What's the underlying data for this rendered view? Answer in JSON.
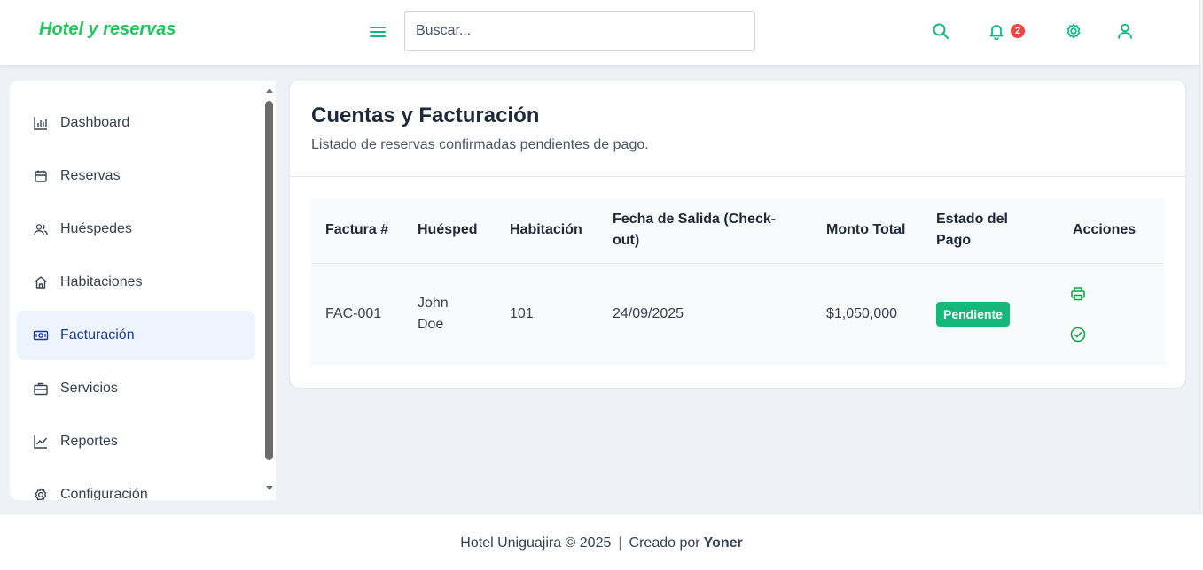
{
  "app": {
    "brand": "Hotel y reservas",
    "accent_color": "#22c55e"
  },
  "header": {
    "search_placeholder": "Buscar...",
    "notification_count": "2",
    "icons": [
      "menu-icon",
      "search-icon",
      "bell-icon",
      "gear-icon",
      "user-icon"
    ]
  },
  "sidebar": {
    "items": [
      {
        "label": "Dashboard",
        "icon": "chart-bar-icon",
        "active": false
      },
      {
        "label": "Reservas",
        "icon": "calendar-icon",
        "active": false
      },
      {
        "label": "Huéspedes",
        "icon": "users-icon",
        "active": false
      },
      {
        "label": "Habitaciones",
        "icon": "home-icon",
        "active": false
      },
      {
        "label": "Facturación",
        "icon": "bill-icon",
        "active": true
      },
      {
        "label": "Servicios",
        "icon": "briefcase-icon",
        "active": false
      },
      {
        "label": "Reportes",
        "icon": "line-chart-icon",
        "active": false
      },
      {
        "label": "Configuración",
        "icon": "gear-icon",
        "active": false
      }
    ]
  },
  "main": {
    "title": "Cuentas y Facturación",
    "subtitle": "Listado de reservas confirmadas pendientes de pago.",
    "table": {
      "columns": [
        "Factura #",
        "Huésped",
        "Habitación",
        "Fecha de Salida (Check-out)",
        "Monto Total",
        "Estado del Pago",
        "Acciones"
      ],
      "rows": [
        {
          "invoice": "FAC-001",
          "guest": "John Doe",
          "room": "101",
          "checkout": "24/09/2025",
          "total": "$1,050,000",
          "status": "Pendiente",
          "status_color": "#16b77a",
          "actions": [
            "printer-icon",
            "check-circle-icon"
          ]
        }
      ]
    }
  },
  "footer": {
    "text": "Hotel Uniguajira © 2025",
    "created_by": "Creado por",
    "author": "Yoner"
  }
}
